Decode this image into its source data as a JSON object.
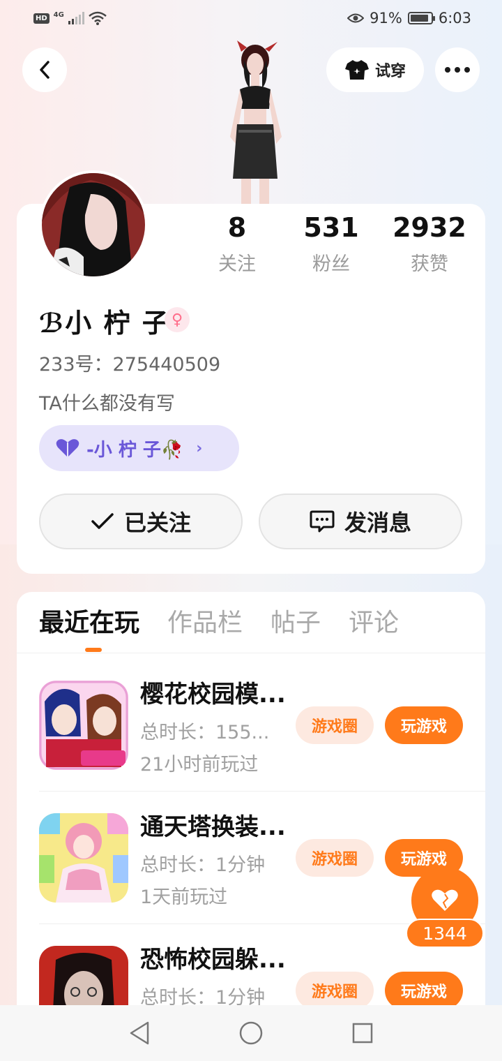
{
  "status_bar": {
    "hd": "HD",
    "network": "4G",
    "battery": "91%",
    "time": "6:03"
  },
  "header": {
    "try_on_label": "试穿"
  },
  "profile": {
    "stats": [
      {
        "value": "8",
        "label": "关注"
      },
      {
        "value": "531",
        "label": "粉丝"
      },
      {
        "value": "2932",
        "label": "获赞"
      }
    ],
    "nickname": "ℬ小 柠 子",
    "gender_symbol": "♀",
    "account_id": "233号：275440509",
    "bio": "TA什么都没有写",
    "fan_group": "-小 柠 子🥀",
    "follow_label": "已关注",
    "message_label": "发消息"
  },
  "tabs": [
    "最近在玩",
    "作品栏",
    "帖子",
    "评论"
  ],
  "games": [
    {
      "title": "樱花校园模...",
      "duration": "总时长：155...",
      "last_played": "21小时前玩过",
      "circle_label": "游戏圈",
      "play_label": "玩游戏"
    },
    {
      "title": "通天塔换装...",
      "duration": "总时长：1分钟",
      "last_played": "1天前玩过",
      "circle_label": "游戏圈",
      "play_label": "玩游戏"
    },
    {
      "title": "恐怖校园躲...",
      "duration": "总时长：1分钟",
      "last_played": "",
      "circle_label": "游戏圈",
      "play_label": "玩游戏"
    }
  ],
  "like_count": "1344",
  "colors": {
    "accent": "#ff7a1a",
    "fan_pill_bg": "#e7e4fb",
    "fan_pill_text": "#6a57d8"
  }
}
